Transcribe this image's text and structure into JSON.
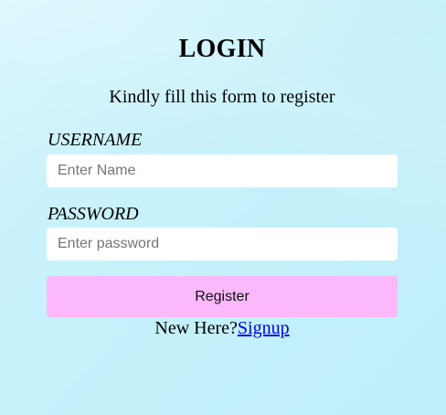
{
  "page": {
    "title": "LOGIN",
    "subtitle": "Kindly fill this form to register"
  },
  "form": {
    "username": {
      "label": "USERNAME",
      "placeholder": "Enter Name",
      "value": ""
    },
    "password": {
      "label": "PASSWORD",
      "placeholder": "Enter password",
      "value": ""
    },
    "submit_label": "Register",
    "signup_prompt": "New Here?",
    "signup_link": "Signup"
  },
  "colors": {
    "background": "#c8f2fc",
    "button": "#fbb8fb",
    "link": "#0000ee",
    "input_background": "#ffffff"
  }
}
